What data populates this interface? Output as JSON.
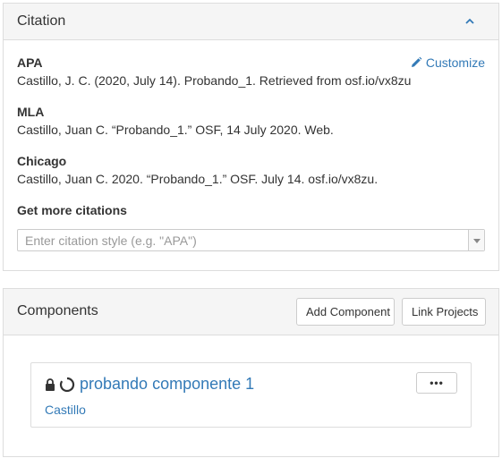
{
  "citation": {
    "title": "Citation",
    "customize_label": "Customize",
    "styles": [
      {
        "name": "APA",
        "text": "Castillo, J. C. (2020, July 14). Probando_1. Retrieved from osf.io/vx8zu"
      },
      {
        "name": "MLA",
        "text": "Castillo, Juan C. “Probando_1.” OSF, 14 July 2020. Web."
      },
      {
        "name": "Chicago",
        "text": "Castillo, Juan C. 2020. “Probando_1.” OSF. July 14. osf.io/vx8zu."
      }
    ],
    "more_heading": "Get more citations",
    "select_placeholder": "Enter citation style (e.g. \"APA\")"
  },
  "components": {
    "title": "Components",
    "add_button": "Add Component",
    "link_button": "Link Projects",
    "items": [
      {
        "title": "probando componente 1",
        "contributor": "Castillo",
        "menu_label": "•••"
      }
    ]
  },
  "icons": {
    "collapse": "chevron-up-icon",
    "customize": "pencil-icon",
    "private": "lock-icon",
    "loading": "spinner-icon",
    "dropdown": "caret-down-icon"
  },
  "colors": {
    "link": "#337ab7",
    "heading_bg": "#f5f5f5",
    "border": "#dddddd"
  }
}
